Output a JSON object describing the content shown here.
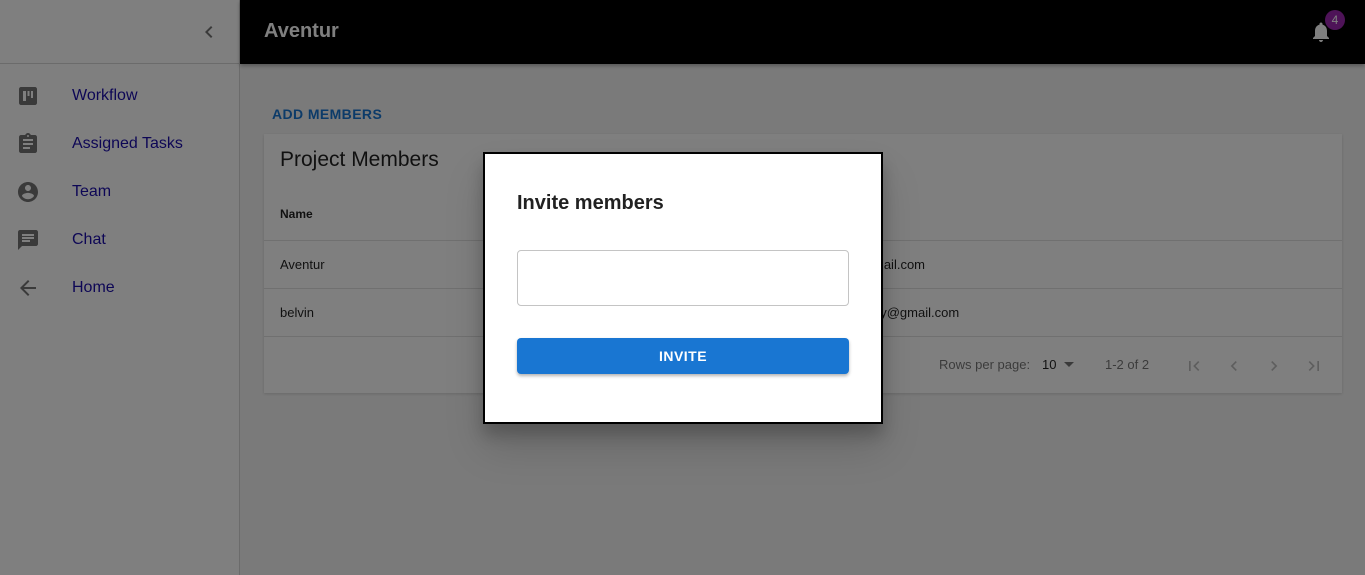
{
  "sidebar": {
    "collapse_icon": "chevron-left-icon",
    "items": [
      {
        "label": "Workflow",
        "icon": "kanban-board-icon"
      },
      {
        "label": "Assigned Tasks",
        "icon": "clipboard-icon"
      },
      {
        "label": "Team",
        "icon": "account-circle-icon"
      },
      {
        "label": "Chat",
        "icon": "chat-icon"
      },
      {
        "label": "Home",
        "icon": "arrow-back-icon"
      }
    ]
  },
  "appbar": {
    "title": "Aventur",
    "notification_count": "4"
  },
  "main": {
    "add_members_label": "ADD MEMBERS",
    "card_title": "Project Members",
    "columns": [
      "Name"
    ],
    "rows": [
      {
        "name": "Aventur",
        "email_visible": "mail.com"
      },
      {
        "name": "belvin",
        "email_visible": "ny@gmail.com"
      }
    ],
    "pagination": {
      "rows_per_page_label": "Rows per page:",
      "rows_per_page_value": "10",
      "range": "1-2 of 2"
    }
  },
  "dialog": {
    "title": "Invite members",
    "input_value": "",
    "invite_label": "INVITE"
  },
  "colors": {
    "appbar": "#000000",
    "primary": "#1976d2",
    "badge": "#9c27b0",
    "nav_link": "#1a0dab"
  }
}
